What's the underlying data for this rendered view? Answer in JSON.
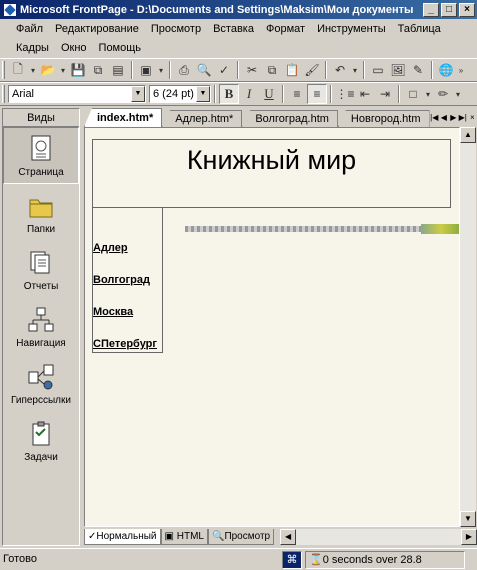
{
  "window": {
    "title": "Microsoft FrontPage - D:\\Documents and Settings\\Maksim\\Мои документы"
  },
  "menu": {
    "items": [
      "Файл",
      "Редактирование",
      "Просмотр",
      "Вставка",
      "Формат",
      "Инструменты",
      "Таблица",
      "Кадры",
      "Окно",
      "Помощь"
    ]
  },
  "toolbar": {
    "font_name": "Arial",
    "font_size": "6  (24 pt)",
    "bold": "B",
    "italic": "I",
    "underline": "U"
  },
  "views_panel": {
    "header": "Виды",
    "items": [
      {
        "label": "Страница",
        "icon": "page-view-icon"
      },
      {
        "label": "Папки",
        "icon": "folder-view-icon"
      },
      {
        "label": "Отчеты",
        "icon": "reports-view-icon"
      },
      {
        "label": "Навигация",
        "icon": "navigation-view-icon"
      },
      {
        "label": "Гиперссылки",
        "icon": "hyperlinks-view-icon"
      },
      {
        "label": "Задачи",
        "icon": "tasks-view-icon"
      }
    ]
  },
  "tabs": [
    {
      "label": "index.htm*",
      "active": true
    },
    {
      "label": "Адлер.htm*",
      "active": false
    },
    {
      "label": "Волгоград.htm",
      "active": false
    },
    {
      "label": "Новгород.htm",
      "active": false
    }
  ],
  "document": {
    "header": "Книжный мир",
    "nav_links": [
      "Адлер",
      "Волгоград",
      "Москва",
      "СПетербург"
    ]
  },
  "bottom_tabs": [
    {
      "label": "Нормальный",
      "active": true
    },
    {
      "label": "HTML",
      "active": false
    },
    {
      "label": "Просмотр",
      "active": false
    }
  ],
  "status": {
    "text": "Готово",
    "timing": "0 seconds over 28.8"
  },
  "colors": {
    "title_bar": "#0a246a",
    "face": "#d4d0c8",
    "document_bg": "#f7f5ea"
  }
}
